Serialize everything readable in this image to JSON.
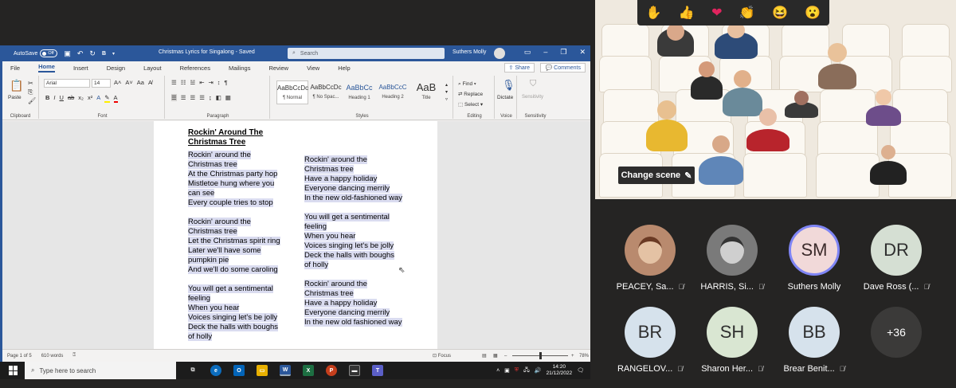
{
  "word": {
    "autosave_label": "AutoSave",
    "autosave_state": "Off",
    "doc_title": "Christmas Lyrics for Singalong - Saved",
    "search_placeholder": "Search",
    "user_name": "Suthers Molly",
    "tabs": [
      "File",
      "Home",
      "Insert",
      "Design",
      "Layout",
      "References",
      "Mailings",
      "Review",
      "View",
      "Help"
    ],
    "share_label": "Share",
    "comments_label": "Comments",
    "font_name": "Arial",
    "font_size": "14",
    "paste_label": "Paste",
    "group_labels": {
      "clipboard": "Clipboard",
      "font": "Font",
      "paragraph": "Paragraph",
      "styles": "Styles",
      "editing": "Editing",
      "voice": "Voice",
      "sensitivity": "Sensitivity"
    },
    "styles": [
      {
        "sample": "AaBbCcDc",
        "name": "¶ Normal"
      },
      {
        "sample": "AaBbCcDc",
        "name": "¶ No Spac..."
      },
      {
        "sample": "AaBbCc",
        "name": "Heading 1"
      },
      {
        "sample": "AaBbCcC",
        "name": "Heading 2"
      },
      {
        "sample": "AaB",
        "name": "Title"
      }
    ],
    "editing": {
      "find": "Find",
      "replace": "Replace",
      "select": "Select"
    },
    "dictate_label": "Dictate",
    "sensitivity_label": "Sensitivity",
    "document": {
      "heading_1": "Rockin' Around The",
      "heading_2": "Christmas Tree",
      "col1": [
        "Rockin' around the",
        "Christmas tree",
        "At the Christmas party hop",
        "Mistletoe hung where you",
        "can see",
        "Every couple tries to stop",
        "",
        "Rockin' around the",
        "Christmas tree",
        "Let the Christmas spirit ring",
        "Later we'll have some",
        "pumpkin pie",
        "And we'll do some caroling",
        "",
        "You will get a sentimental",
        "feeling",
        "When you hear",
        "Voices singing let's be jolly",
        "Deck the halls with boughs",
        "of holly"
      ],
      "col2": [
        "Rockin' around the",
        "Christmas tree",
        "Have a happy holiday",
        "Everyone dancing merrily",
        "In the new old-fashioned way",
        "",
        "You will get a sentimental",
        "feeling",
        "When you hear",
        "Voices singing let's be jolly",
        "Deck the halls with boughs",
        "of holly",
        "",
        "Rockin' around the",
        "Christmas tree",
        "Have a happy holiday",
        "Everyone dancing merrily",
        "In the new old fashioned way"
      ]
    },
    "status": {
      "page": "Page 1 of 5",
      "words": "610 words",
      "focus": "Focus",
      "zoom": "78%"
    }
  },
  "taskbar": {
    "search_placeholder": "Type here to search",
    "time": "14:20",
    "date": "21/12/2022"
  },
  "teams": {
    "reactions": [
      "✋",
      "👍",
      "❤",
      "👏",
      "😆",
      "😮"
    ],
    "change_scene_label": "Change scene",
    "participants": [
      {
        "initials": "",
        "name": "PEACEY, Sa...",
        "photo": true
      },
      {
        "initials": "",
        "name": "HARRIS, Si...",
        "photo": true
      },
      {
        "initials": "SM",
        "name": "Suthers Molly",
        "photo": false
      },
      {
        "initials": "DR",
        "name": "Dave Ross (...",
        "photo": false
      },
      {
        "initials": "BR",
        "name": "RANGELOV...",
        "photo": false
      },
      {
        "initials": "SH",
        "name": "Sharon Her...",
        "photo": false
      },
      {
        "initials": "BB",
        "name": "Brear Benit...",
        "photo": false
      },
      {
        "initials": "+36",
        "name": "",
        "photo": false
      }
    ]
  }
}
